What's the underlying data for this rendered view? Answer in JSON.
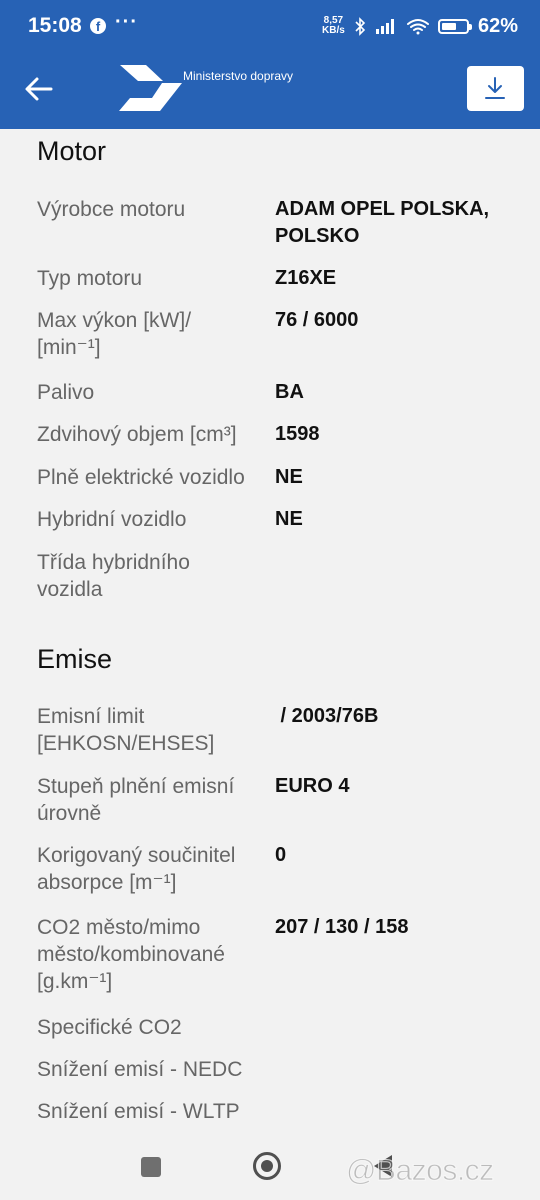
{
  "status_bar": {
    "time": "15:08",
    "notification_icons": [
      "facebook-icon",
      "more-icon"
    ],
    "more_glyph": "···",
    "facebook_glyph": "f",
    "net_speed_value": "8,57",
    "net_speed_unit": "KB/s",
    "battery_percent": "62%",
    "battery_level": 0.62,
    "icons": [
      "bluetooth-icon",
      "signal-icon",
      "wifi-icon",
      "battery-icon"
    ]
  },
  "header": {
    "brand": "Ministerstvo dopravy",
    "back_icon": "arrow-left-icon",
    "download_icon": "download-icon",
    "background_color": "#2762b5"
  },
  "sections": [
    {
      "title": "Motor",
      "rows": [
        {
          "label": "Výrobce motoru",
          "value": "ADAM OPEL POLSKA,\nPOLSKO"
        },
        {
          "label": "Typ motoru",
          "value": "Z16XE"
        },
        {
          "label": "Max výkon [kW]/\n[min⁻¹]",
          "value": "76 / 6000"
        },
        {
          "label": "Palivo",
          "value": "BA"
        },
        {
          "label": "Zdvihový objem [cm³]",
          "value": "1598"
        },
        {
          "label": "Plně elektrické vozidlo",
          "value": "NE"
        },
        {
          "label": "Hybridní vozidlo",
          "value": "NE"
        },
        {
          "label": "Třída hybridního\nvozidla",
          "value": ""
        }
      ]
    },
    {
      "title": "Emise",
      "rows": [
        {
          "label": "Emisní limit\n[EHKOSN/EHSES]",
          "value": " / 2003/76B"
        },
        {
          "label": "Stupeň plnění emisní\núrovně",
          "value": "EURO 4"
        },
        {
          "label": "Korigovaný součinitel\nabsorpce [m⁻¹]",
          "value": "0"
        },
        {
          "label": "CO2 město/mimo\nměsto/kombinované\n[g.km⁻¹]",
          "value": "207 / 130 / 158"
        },
        {
          "label": "Specifické CO2",
          "value": ""
        },
        {
          "label": "Snížení emisí - NEDC",
          "value": ""
        },
        {
          "label": "Snížení emisí - WLTP",
          "value": ""
        }
      ]
    }
  ],
  "watermark": "@Bazos.cz",
  "nav_bar": {
    "icons": [
      "recents-icon",
      "home-icon",
      "back-icon"
    ]
  }
}
